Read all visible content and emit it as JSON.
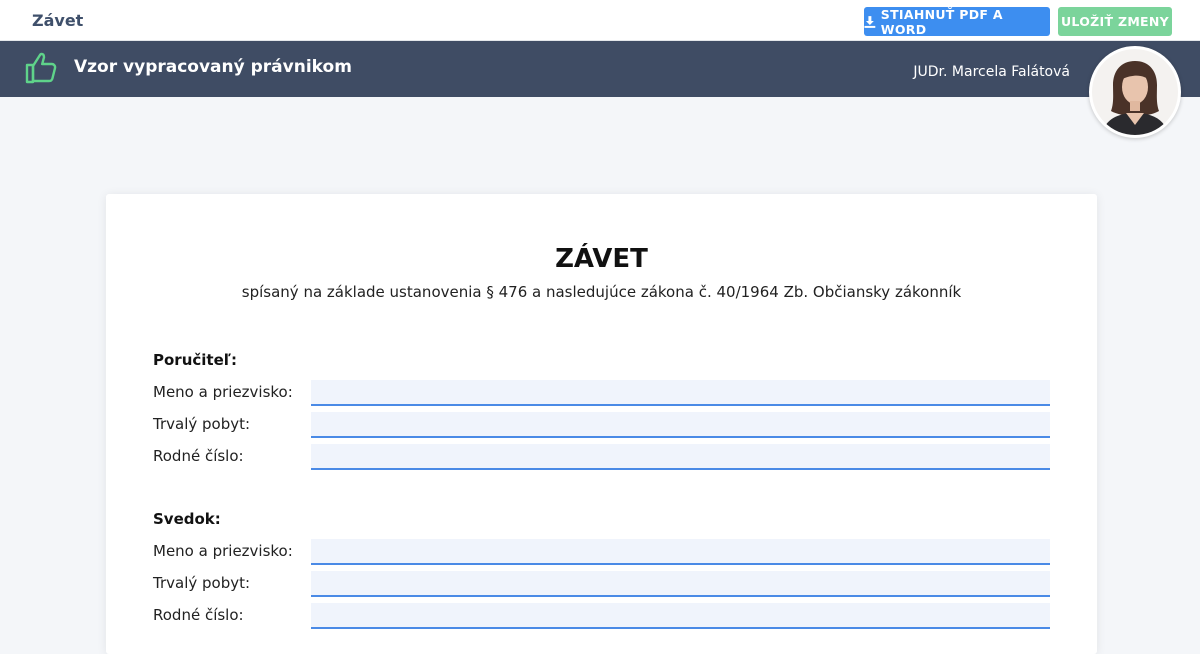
{
  "topbar": {
    "title": "Závet",
    "download_label": "STIAHNUŤ PDF A WORD",
    "save_label": "ULOŽIŤ ZMENY"
  },
  "banner": {
    "label": "Vzor vypracovaný právnikom",
    "lawyer_name": "JUDr. Marcela Falátová"
  },
  "document": {
    "title": "ZÁVET",
    "subtitle": "spísaný na základe ustanovenia § 476 a nasledujúce zákona č. 40/1964 Zb. Občiansky zákonník",
    "sections": [
      {
        "title": "Poručiteľ:",
        "fields": [
          {
            "label": "Meno a priezvisko:",
            "value": ""
          },
          {
            "label": "Trvalý pobyt:",
            "value": ""
          },
          {
            "label": "Rodné číslo:",
            "value": ""
          }
        ]
      },
      {
        "title": "Svedok:",
        "fields": [
          {
            "label": "Meno a priezvisko:",
            "value": ""
          },
          {
            "label": "Trvalý pobyt:",
            "value": ""
          },
          {
            "label": "Rodné číslo:",
            "value": ""
          }
        ]
      }
    ]
  },
  "colors": {
    "primary_blue": "#3d8ef0",
    "save_green": "#7bd49b",
    "banner_bg": "#3f4c64",
    "thumb_green": "#5fd38a",
    "input_underline": "#4a8ae6"
  },
  "icons": {
    "download": "download-icon",
    "thumb": "thumbs-up-icon",
    "avatar": "lawyer-avatar"
  }
}
